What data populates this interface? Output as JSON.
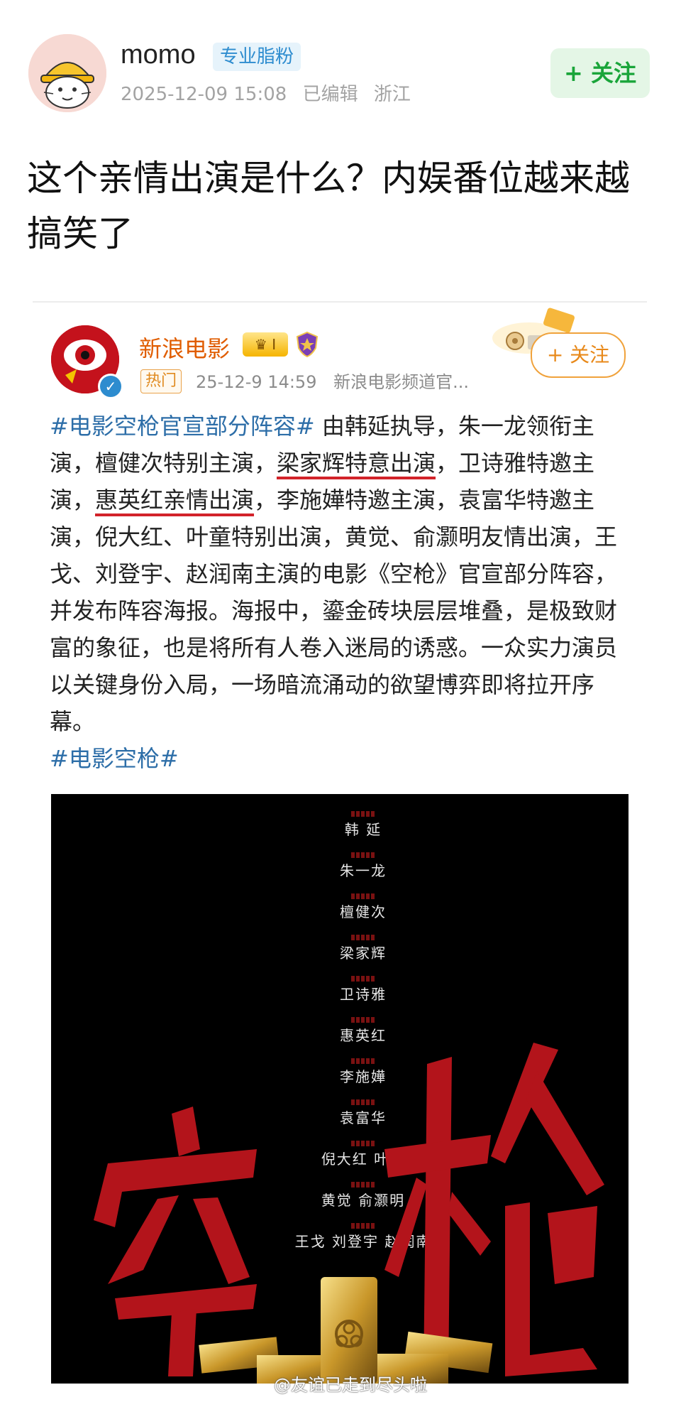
{
  "post": {
    "username": "momo",
    "fan_badge": "专业脂粉",
    "timestamp": "2025-12-09 15:08",
    "edited": "已编辑",
    "location": "浙江",
    "follow_label": "+ 关注",
    "title": "这个亲情出演是什么？内娱番位越来越搞笑了"
  },
  "quoted": {
    "author": "新浪电影",
    "level_badge": "I",
    "hot_tag": "热门",
    "timestamp": "25-12-9 14:59",
    "source": "新浪电影频道官...",
    "follow_label": "+ 关注",
    "body": {
      "topic1": "#电影空枪官宣部分阵容#",
      "seg1": " 由韩延执导，朱一龙领衔主演，檀健次特别主演，",
      "underline1": "梁家辉特意出演",
      "seg2": "，卫诗雅特邀主演，",
      "underline2": "惠英红亲情出演",
      "seg3": "，李施嬅特邀主演，袁富华特邀主演，倪大红、叶童特别出演，黄觉、俞灏明友情出演，王戈、刘登宇、赵润南主演的电影《空枪》官宣部分阵容，并发布阵容海报。海报中，鎏金砖块层层堆叠，是极致财富的象征，也是将所有人卷入迷局的诱惑。一众实力演员以关键身份入局，一场暗流涌动的欲望博弈即将拉开序幕。",
      "topic2": "#电影空枪#"
    },
    "poster": {
      "cast": [
        "韩 延",
        "朱一龙",
        "檀健次",
        "梁家辉",
        "卫诗雅",
        "惠英红",
        "李施嬅",
        "袁富华",
        "倪大红  叶童",
        "黄觉  俞灏明",
        "王戈  刘登宇  赵润南"
      ]
    }
  },
  "watermark": "@友谊已走到尽头啦",
  "colors": {
    "topic": "#2d6ea8",
    "underline": "#d2232a",
    "follow_green": "#1aa53a",
    "follow_orange": "#e8891a"
  }
}
